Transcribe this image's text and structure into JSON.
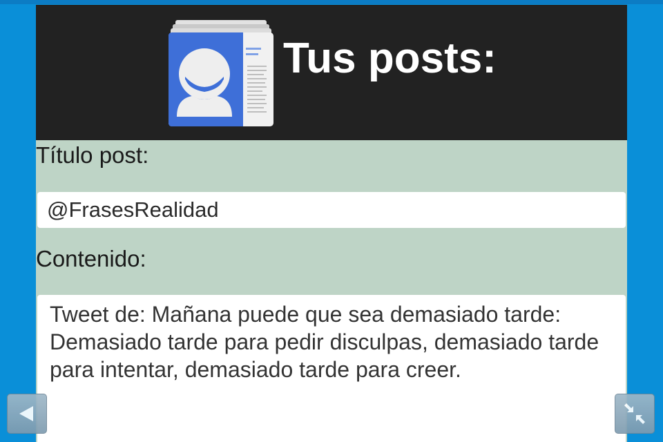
{
  "header": {
    "title": "Tus posts:",
    "icon": "contacts-app-icon"
  },
  "form": {
    "title_label": "Título post:",
    "title_value": "@FrasesRealidad",
    "content_label": "Contenido:",
    "content_value": "Tweet de: Mañana puede que sea demasiado tarde: Demasiado tarde para pedir disculpas, demasiado tarde para intentar, demasiado tarde para creer."
  },
  "controls": {
    "back_icon": "back-arrow-icon",
    "shrink_icon": "shrink-arrows-icon"
  },
  "colors": {
    "background": "#0a8fd8",
    "header_bg": "#222222",
    "form_bg": "#bed4c6",
    "icon_blue": "#3e6fd8"
  }
}
